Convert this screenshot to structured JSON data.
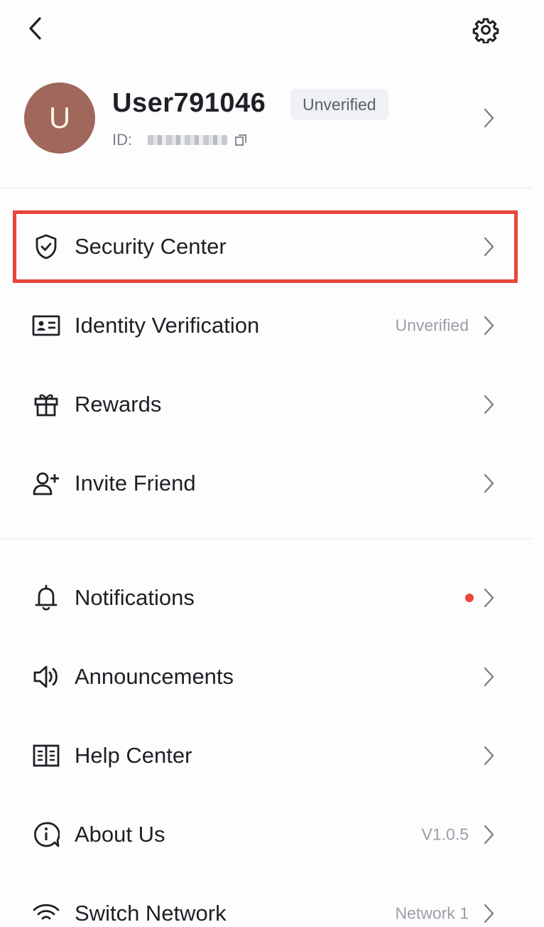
{
  "header": {
    "back_icon": "chevron-left-icon",
    "settings_icon": "gear-icon"
  },
  "profile": {
    "avatar_initial": "U",
    "avatar_color": "#a0675d",
    "username": "User791046",
    "verification_badge": "Unverified",
    "id_label": "ID:",
    "id_value_obscured": true
  },
  "menu_group_1": [
    {
      "id": "security-center",
      "label": "Security Center",
      "icon": "shield-check-icon",
      "value": "",
      "highlighted": true
    },
    {
      "id": "identity-verification",
      "label": "Identity Verification",
      "icon": "id-card-icon",
      "value": "Unverified"
    },
    {
      "id": "rewards",
      "label": "Rewards",
      "icon": "gift-icon",
      "value": ""
    },
    {
      "id": "invite-friend",
      "label": "Invite Friend",
      "icon": "user-plus-icon",
      "value": ""
    }
  ],
  "menu_group_2": [
    {
      "id": "notifications",
      "label": "Notifications",
      "icon": "bell-icon",
      "value": "",
      "unread_dot": true
    },
    {
      "id": "announcements",
      "label": "Announcements",
      "icon": "speaker-icon",
      "value": ""
    },
    {
      "id": "help-center",
      "label": "Help Center",
      "icon": "book-icon",
      "value": ""
    },
    {
      "id": "about-us",
      "label": "About Us",
      "icon": "info-icon",
      "value": "V1.0.5"
    },
    {
      "id": "switch-network",
      "label": "Switch Network",
      "icon": "wifi-icon",
      "value": "Network 1"
    }
  ],
  "colors": {
    "highlight": "#e8463b",
    "unread_dot": "#e8463b",
    "text_primary": "#1f2026",
    "text_secondary": "#9a9ea7"
  }
}
